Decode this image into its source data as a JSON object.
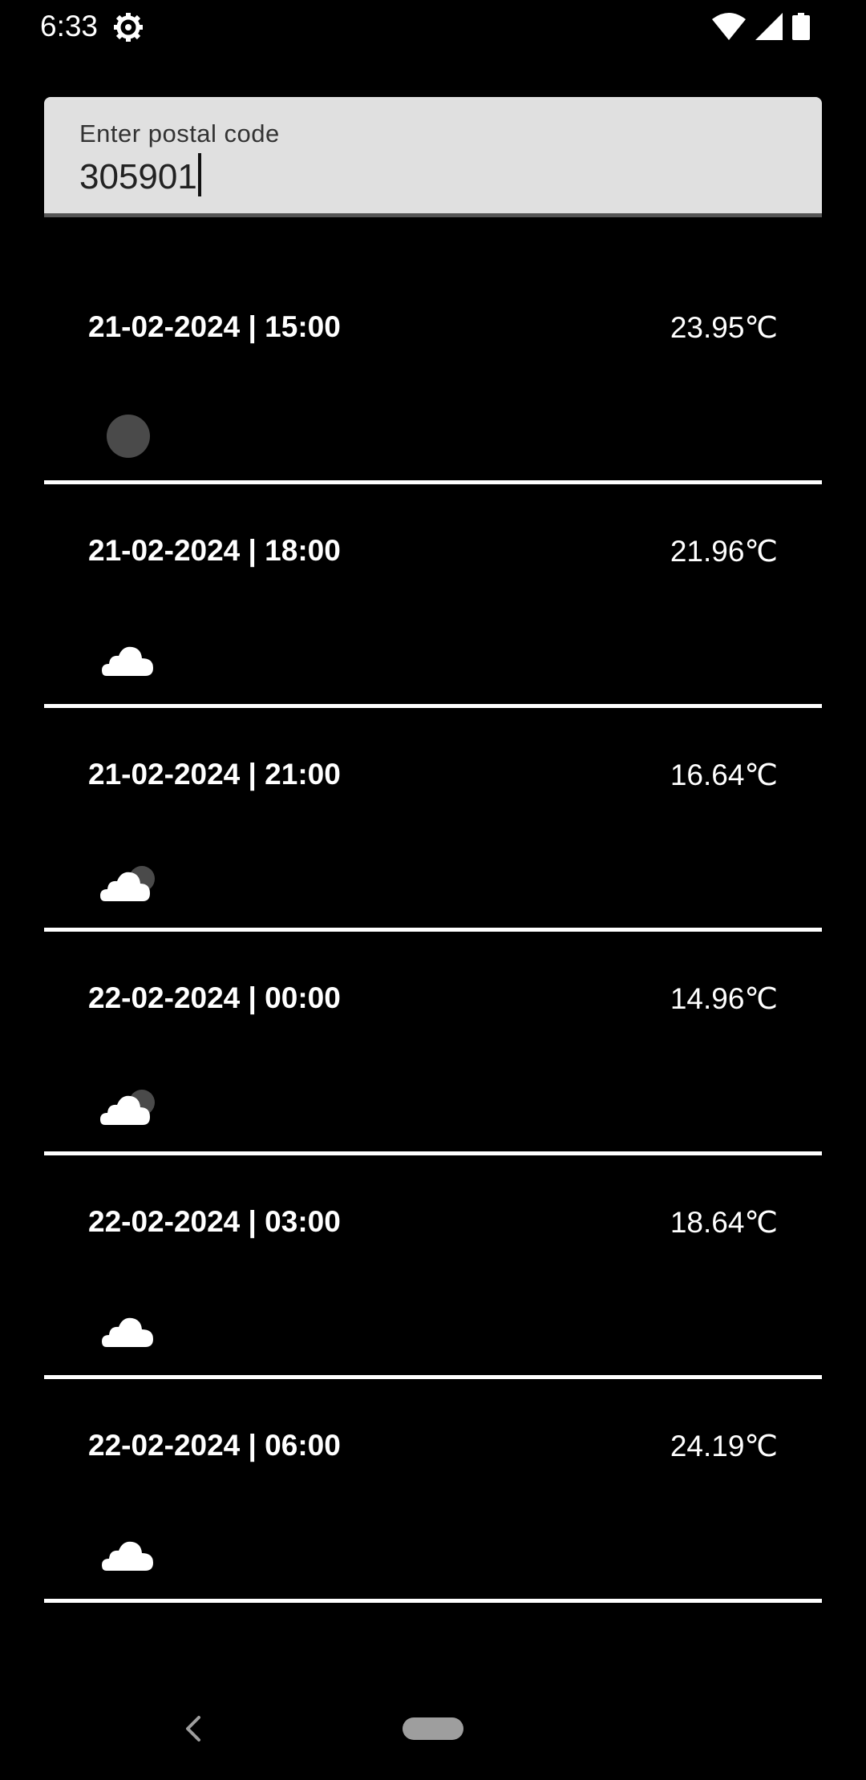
{
  "status_bar": {
    "time": "6:33",
    "icons": [
      "settings-gear-icon",
      "wifi-icon",
      "cellular-signal-icon",
      "battery-icon"
    ]
  },
  "postal": {
    "label": "Enter postal code",
    "value": "305901"
  },
  "forecast": [
    {
      "datetime": "21-02-2024 | 15:00",
      "temp": "23.95℃",
      "icon": "moon-icon"
    },
    {
      "datetime": "21-02-2024 | 18:00",
      "temp": "21.96℃",
      "icon": "cloud-icon"
    },
    {
      "datetime": "21-02-2024 | 21:00",
      "temp": "16.64℃",
      "icon": "cloud-moon-icon"
    },
    {
      "datetime": "22-02-2024 | 00:00",
      "temp": "14.96℃",
      "icon": "cloud-moon-icon"
    },
    {
      "datetime": "22-02-2024 | 03:00",
      "temp": "18.64℃",
      "icon": "cloud-icon"
    },
    {
      "datetime": "22-02-2024 | 06:00",
      "temp": "24.19℃",
      "icon": "cloud-icon"
    }
  ],
  "nav_bar": {
    "icons": [
      "back-icon",
      "home-pill-icon"
    ]
  },
  "colors": {
    "background": "#000000",
    "field_bg": "#e0e0e0",
    "divider": "#ffffff",
    "moon": "#4a4a4a"
  }
}
